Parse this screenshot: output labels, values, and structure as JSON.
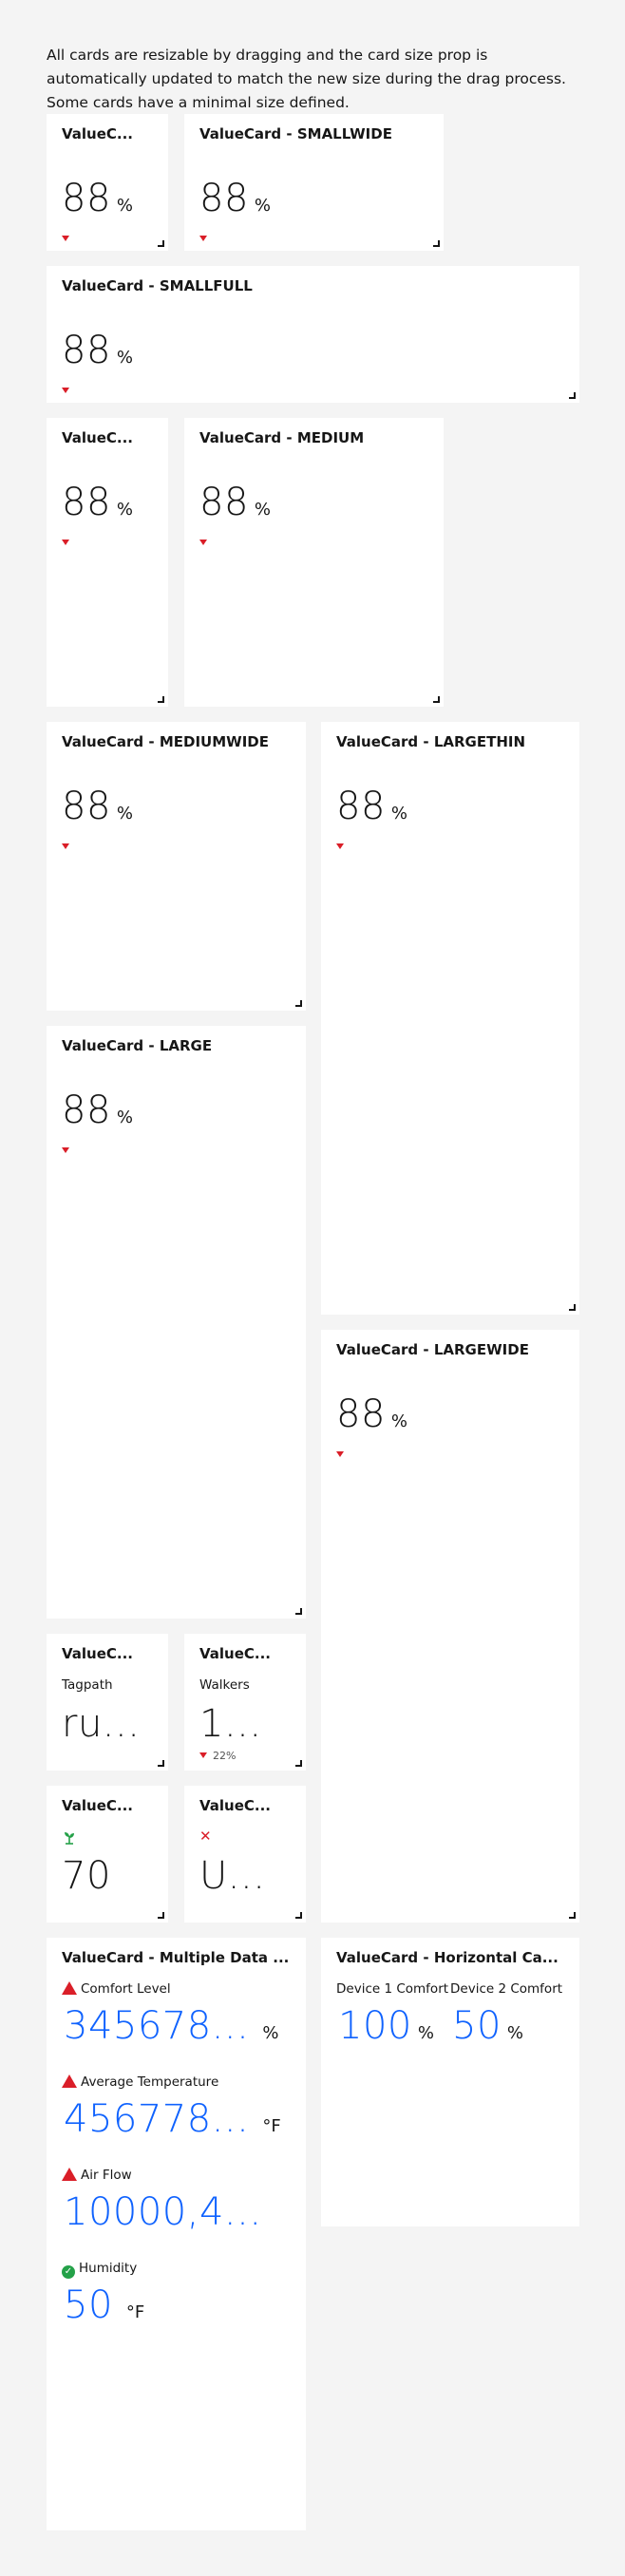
{
  "intro_text": "All cards are resizable by dragging and the card size prop is automatically updated to match the new size during the drag process. Some cards have a minimal size defined.",
  "colors": {
    "background": "#f4f4f4",
    "card": "#ffffff",
    "trend_down": "#da1e28",
    "blue_value": "#0f62fe",
    "ok_green": "#24a148"
  },
  "value_default": "88",
  "unit_percent": "%",
  "cards": {
    "small": {
      "title": "ValueC..."
    },
    "smallwide": {
      "title": "ValueCard - SMALLWIDE"
    },
    "smallfull": {
      "title": "ValueCard - SMALLFULL"
    },
    "medium_thin": {
      "title": "ValueC..."
    },
    "medium": {
      "title": "ValueCard - MEDIUM"
    },
    "mediumwide": {
      "title": "ValueCard - MEDIUMWIDE"
    },
    "largethin": {
      "title": "ValueCard - LARGETHIN"
    },
    "large": {
      "title": "ValueCard - LARGE"
    },
    "largewide": {
      "title": "ValueCard - LARGEWIDE"
    },
    "tagpath": {
      "title": "ValueC...",
      "label": "Tagpath",
      "value": "ru..."
    },
    "walkers": {
      "title": "ValueC...",
      "label": "Walkers",
      "value": "1...",
      "trend": "22%"
    },
    "icon_card": {
      "title": "ValueC...",
      "icon": "plant-icon",
      "value": "70"
    },
    "error_card": {
      "title": "ValueC...",
      "icon": "close-icon",
      "value": "U..."
    },
    "multiple": {
      "title": "ValueCard - Multiple Data ...",
      "items": [
        {
          "label": "Comfort Level",
          "value": "345678...",
          "unit": "%",
          "status": "warning"
        },
        {
          "label": "Average Temperature",
          "value": "456778...",
          "unit": "°F",
          "status": "warning"
        },
        {
          "label": "Air Flow",
          "value": "10000,4...",
          "unit": "",
          "status": "warning"
        },
        {
          "label": "Humidity",
          "value": "50",
          "unit": "°F",
          "status": "ok"
        }
      ]
    },
    "horizontal": {
      "title": "ValueCard - Horizontal Ca...",
      "items": [
        {
          "label": "Device 1 Comfort",
          "value": "100",
          "unit": "%"
        },
        {
          "label": "Device 2 Comfort",
          "value": "50",
          "unit": "%"
        }
      ]
    }
  }
}
